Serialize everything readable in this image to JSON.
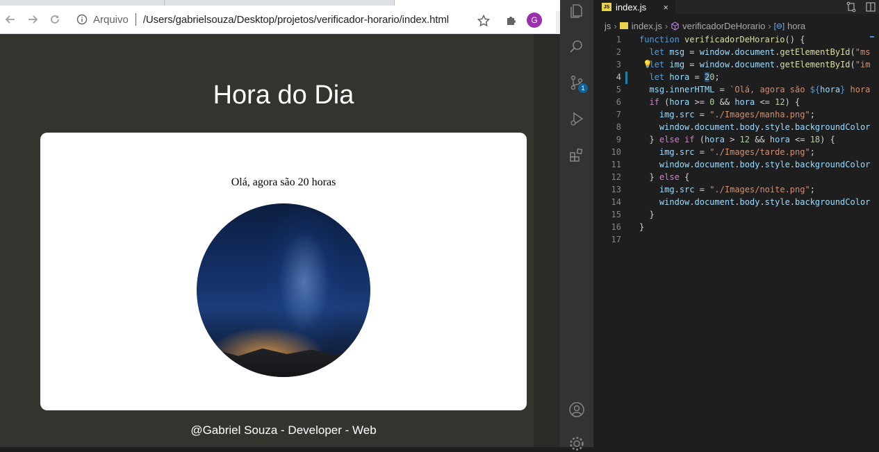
{
  "browser": {
    "toolbar": {
      "scheme_label": "Arquivo",
      "url": "/Users/gabrielsouza/Desktop/projetos/verificador-horario/index.html",
      "profile_initial": "G"
    },
    "page": {
      "title": "Hora do Dia",
      "message": "Olá, agora são 20 horas",
      "footer": "@Gabriel Souza - Developer - Web"
    }
  },
  "editor": {
    "tab": {
      "icon_text": "JS",
      "label": "index.js",
      "close": "×"
    },
    "badge_count": "1",
    "breadcrumb": {
      "folder": "js",
      "file": "index.js",
      "function": "verificadorDeHorario",
      "variable": "hora"
    },
    "lines": [
      {
        "n": "1"
      },
      {
        "n": "2"
      },
      {
        "n": "3"
      },
      {
        "n": "4"
      },
      {
        "n": "5"
      },
      {
        "n": "6"
      },
      {
        "n": "7"
      },
      {
        "n": "8"
      },
      {
        "n": "9"
      },
      {
        "n": "10"
      },
      {
        "n": "11"
      },
      {
        "n": "12"
      },
      {
        "n": "13"
      },
      {
        "n": "14"
      },
      {
        "n": "15"
      },
      {
        "n": "16"
      },
      {
        "n": "17"
      }
    ],
    "code": {
      "l1": [
        "function",
        "verificadorDeHorario",
        "() {"
      ],
      "l2": [
        "let",
        "msg",
        " = ",
        "window",
        ".",
        "document",
        ".",
        "getElementById",
        "(",
        "\"ms"
      ],
      "l3": [
        "let",
        "img",
        " = ",
        "window",
        ".",
        "document",
        ".",
        "getElementById",
        "(",
        "\"im"
      ],
      "l4": [
        "let",
        "hora",
        " = ",
        "2",
        "0",
        ";"
      ],
      "l5": [
        "msg",
        ".",
        "innerHTML",
        " = ",
        "`Olá, agora são ",
        "${",
        "hora",
        "}",
        " hora"
      ],
      "l6": [
        "if",
        " (",
        "hora",
        " >= ",
        "0",
        " && ",
        "hora",
        " <= ",
        "12",
        ") {"
      ],
      "l7": [
        "img",
        ".",
        "src",
        " = ",
        "\"./Images/manha.png\"",
        ";"
      ],
      "l8": [
        "window",
        ".",
        "document",
        ".",
        "body",
        ".",
        "style",
        ".",
        "backgroundColor"
      ],
      "l9": [
        "} ",
        "else if",
        " (",
        "hora",
        " > ",
        "12",
        " && ",
        "hora",
        " <= ",
        "18",
        ") {"
      ],
      "l10": [
        "img",
        ".",
        "src",
        " = ",
        "\"./Images/tarde.png\"",
        ";"
      ],
      "l11": [
        "window",
        ".",
        "document",
        ".",
        "body",
        ".",
        "style",
        ".",
        "backgroundColor"
      ],
      "l12": [
        "} ",
        "else",
        " {"
      ],
      "l13": [
        "img",
        ".",
        "src",
        " = ",
        "\"./Images/noite.png\"",
        ";"
      ],
      "l14": [
        "window",
        ".",
        "document",
        ".",
        "body",
        ".",
        "style",
        ".",
        "backgroundColor"
      ],
      "l15": [
        "}"
      ],
      "l16": [
        "}"
      ]
    }
  },
  "colors": {
    "page_background": "#34342f",
    "card": "#ffffff",
    "editor_background": "#1e1e1e",
    "activity_bar": "#333333",
    "keyword": "#569cd6",
    "function": "#dcdcaa",
    "variable": "#9cdcfe",
    "string": "#ce9178",
    "number": "#b5cea8",
    "control": "#c586c0"
  },
  "icons": [
    "back-arrow-icon",
    "forward-arrow-icon",
    "reload-icon",
    "info-icon",
    "star-icon",
    "extensions-puzzle-icon",
    "files-icon",
    "search-icon",
    "source-control-icon",
    "run-debug-icon",
    "extensions-icon",
    "account-icon",
    "settings-gear-icon",
    "lightbulb-icon",
    "open-changes-icon",
    "split-editor-icon"
  ]
}
